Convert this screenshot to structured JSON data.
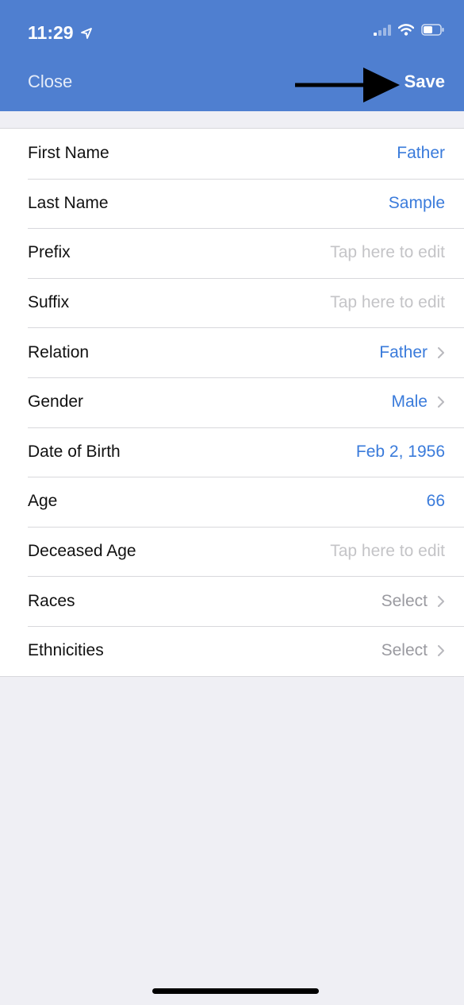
{
  "status_bar": {
    "time": "11:29"
  },
  "nav": {
    "close_label": "Close",
    "save_label": "Save"
  },
  "colors": {
    "header": "#4f7fd0",
    "value_blue": "#3a7bdb",
    "placeholder_gray": "#c4c4c7",
    "background": "#efeff4"
  },
  "form": {
    "rows": [
      {
        "label": "First Name",
        "value": "Father",
        "style": "blue",
        "chevron": false
      },
      {
        "label": "Last Name",
        "value": "Sample",
        "style": "blue",
        "chevron": false
      },
      {
        "label": "Prefix",
        "value": "Tap here to edit",
        "style": "gray",
        "chevron": false
      },
      {
        "label": "Suffix",
        "value": "Tap here to edit",
        "style": "gray",
        "chevron": false
      },
      {
        "label": "Relation",
        "value": "Father",
        "style": "blue",
        "chevron": true
      },
      {
        "label": "Gender",
        "value": "Male",
        "style": "blue",
        "chevron": true
      },
      {
        "label": "Date of Birth",
        "value": "Feb 2, 1956",
        "style": "blue",
        "chevron": false
      },
      {
        "label": "Age",
        "value": "66",
        "style": "blue",
        "chevron": false
      },
      {
        "label": "Deceased Age",
        "value": "Tap here to edit",
        "style": "gray",
        "chevron": false
      },
      {
        "label": "Races",
        "value": "Select",
        "style": "select",
        "chevron": true
      },
      {
        "label": "Ethnicities",
        "value": "Select",
        "style": "select",
        "chevron": true
      }
    ]
  }
}
